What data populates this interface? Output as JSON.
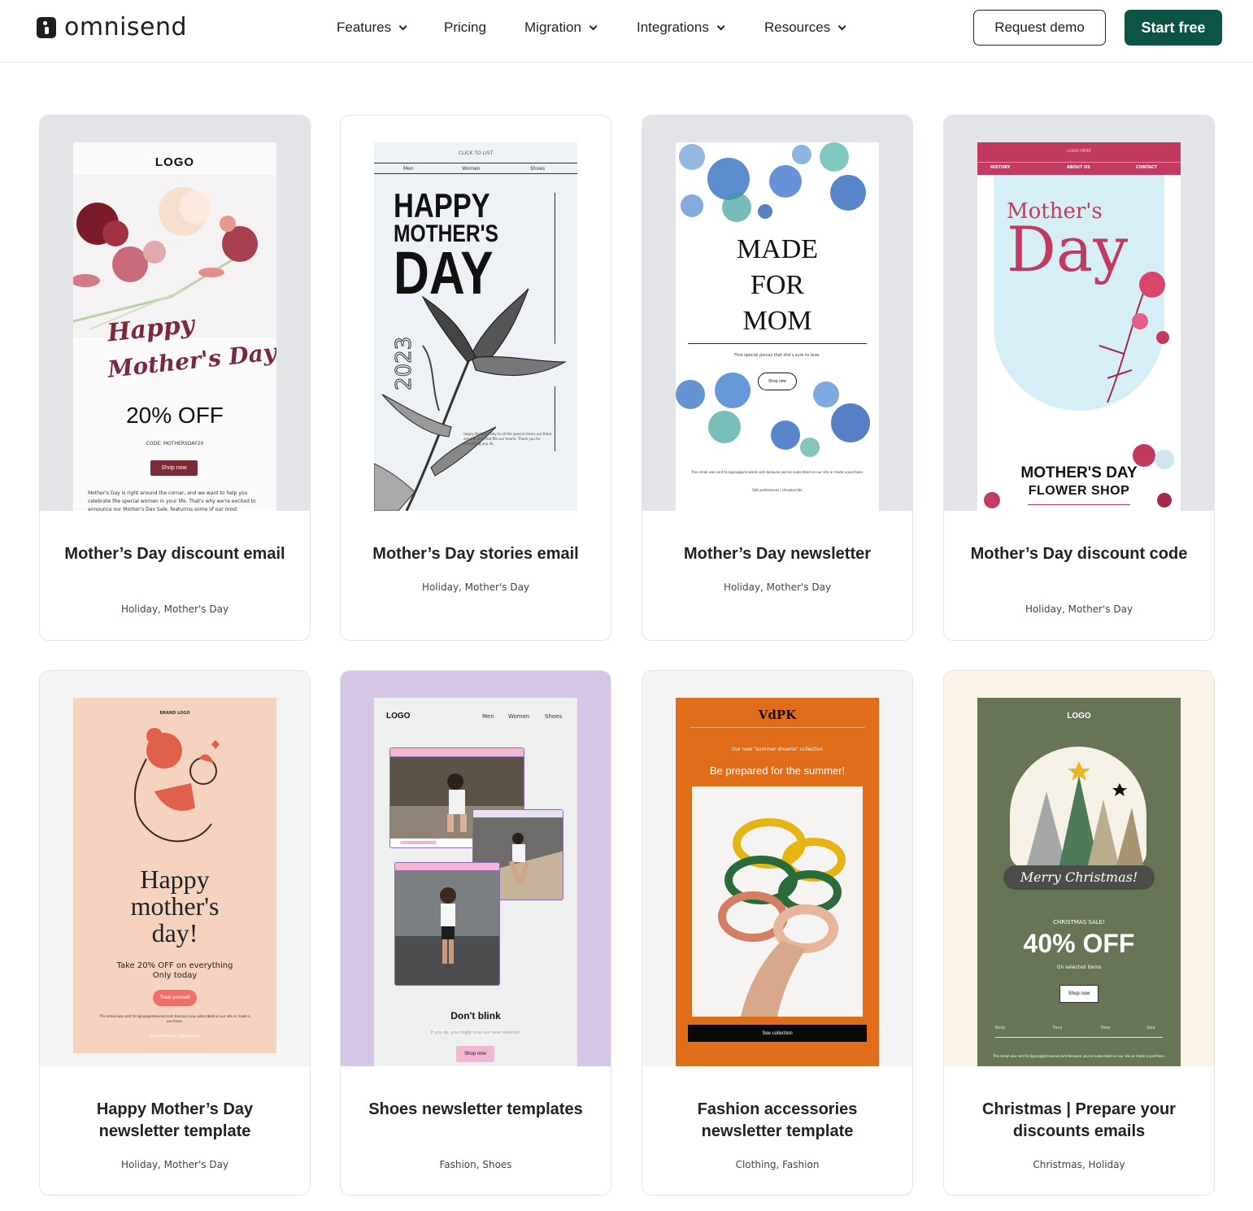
{
  "header": {
    "brand": "omnisend",
    "nav": [
      {
        "label": "Features",
        "has_dropdown": true
      },
      {
        "label": "Pricing",
        "has_dropdown": false
      },
      {
        "label": "Migration",
        "has_dropdown": true
      },
      {
        "label": "Integrations",
        "has_dropdown": true
      },
      {
        "label": "Resources",
        "has_dropdown": true
      }
    ],
    "request_demo": "Request demo",
    "start_free": "Start free",
    "accent_color": "#0c5446"
  },
  "cards": [
    {
      "title": "Mother’s Day discount email",
      "tags": "Holiday, Mother's Day",
      "preview": {
        "logo": "LOGO",
        "script_line1": "Happy",
        "script_line2": "Mother's Day",
        "offer": "20% OFF",
        "code": "CODE: MOTHERSDAY20",
        "button": "Shop now",
        "body": "Mother's Day is right around the corner, and we want to help you celebrate the special women in your life. That's why we're excited to announce our Mother's Day Sale, featuring some of our most"
      }
    },
    {
      "title": "Mother’s Day stories email",
      "tags": "Holiday, Mother's Day",
      "preview": {
        "top": "CLICK TO LIST",
        "menu": [
          "Men",
          "Women",
          "Shoes"
        ],
        "headline1": "HAPPY",
        "headline2": "MOTHER'S",
        "headline3": "DAY",
        "year": "2023",
        "note": "Happy Mother's Day to all the special moms out there and the love that fills our hearts. Thank you for everything you do."
      }
    },
    {
      "title": "Mother’s Day newsletter",
      "tags": "Holiday, Mother's Day",
      "preview": {
        "headline1": "MADE",
        "headline2": "FOR",
        "headline3": "MOM",
        "sub": "Find special pieces that she's sure to love.",
        "button": "Shop now",
        "footer": "This email was sent to lignas@omnisend.com because you've subscribed on our site or made a purchase.",
        "links": "Edit preferences | Unsubscribe"
      }
    },
    {
      "title": "Mother’s Day discount code",
      "tags": "Holiday, Mother's Day",
      "preview": {
        "top": "LOGO HERE",
        "menu": [
          "HISTORY",
          "ABOUT US",
          "CONTACT"
        ],
        "script1": "Mother's",
        "script2": "Day",
        "shop1": "MOTHER'S DAY",
        "shop2": "FLOWER SHOP"
      }
    },
    {
      "title": "Happy Mother’s Day newsletter template",
      "tags": "Holiday, Mother's Day",
      "preview": {
        "logo": "BRAND LOGO",
        "headline1": "Happy",
        "headline2": "mother's",
        "headline3": "day!",
        "offer": "Take 20% OFF on everything",
        "offer2": "Only today",
        "button": "Treat yourself",
        "footer": "This email was sent to lignas@omnisend.com because you subscribed on our site or made a purchase.",
        "links": "Edit preferences | Unsubscribe"
      }
    },
    {
      "title": "Shoes newsletter templates",
      "tags": "Fashion, Shoes",
      "preview": {
        "logo": "LOGO",
        "menu": [
          "Men",
          "Women",
          "Shoes"
        ],
        "headline": "Don't blink",
        "sub": "If you do, you might miss our new collection",
        "button": "Shop now"
      }
    },
    {
      "title": "Fashion accessories newsletter template",
      "tags": "Clothing, Fashion",
      "preview": {
        "brand": "VdPK",
        "kicker": "Our new \"summer dreams\" collection",
        "headline": "Be prepared for the summer!",
        "button": "See collection"
      }
    },
    {
      "title": "Christmas | Prepare your discounts emails",
      "tags": "Christmas, Holiday",
      "preview": {
        "logo": "LOGO",
        "script": "Merry Christmas!",
        "kicker": "CHRISTMAS SALE!",
        "offer": "40% OFF",
        "sub": "On selected items",
        "button": "Shop now",
        "menu": [
          "Body",
          "Face",
          "New",
          "Sale"
        ],
        "footer": "This email was sent to lignas@omnisend.com because you've subscribed on our site or made a purchase."
      }
    }
  ]
}
